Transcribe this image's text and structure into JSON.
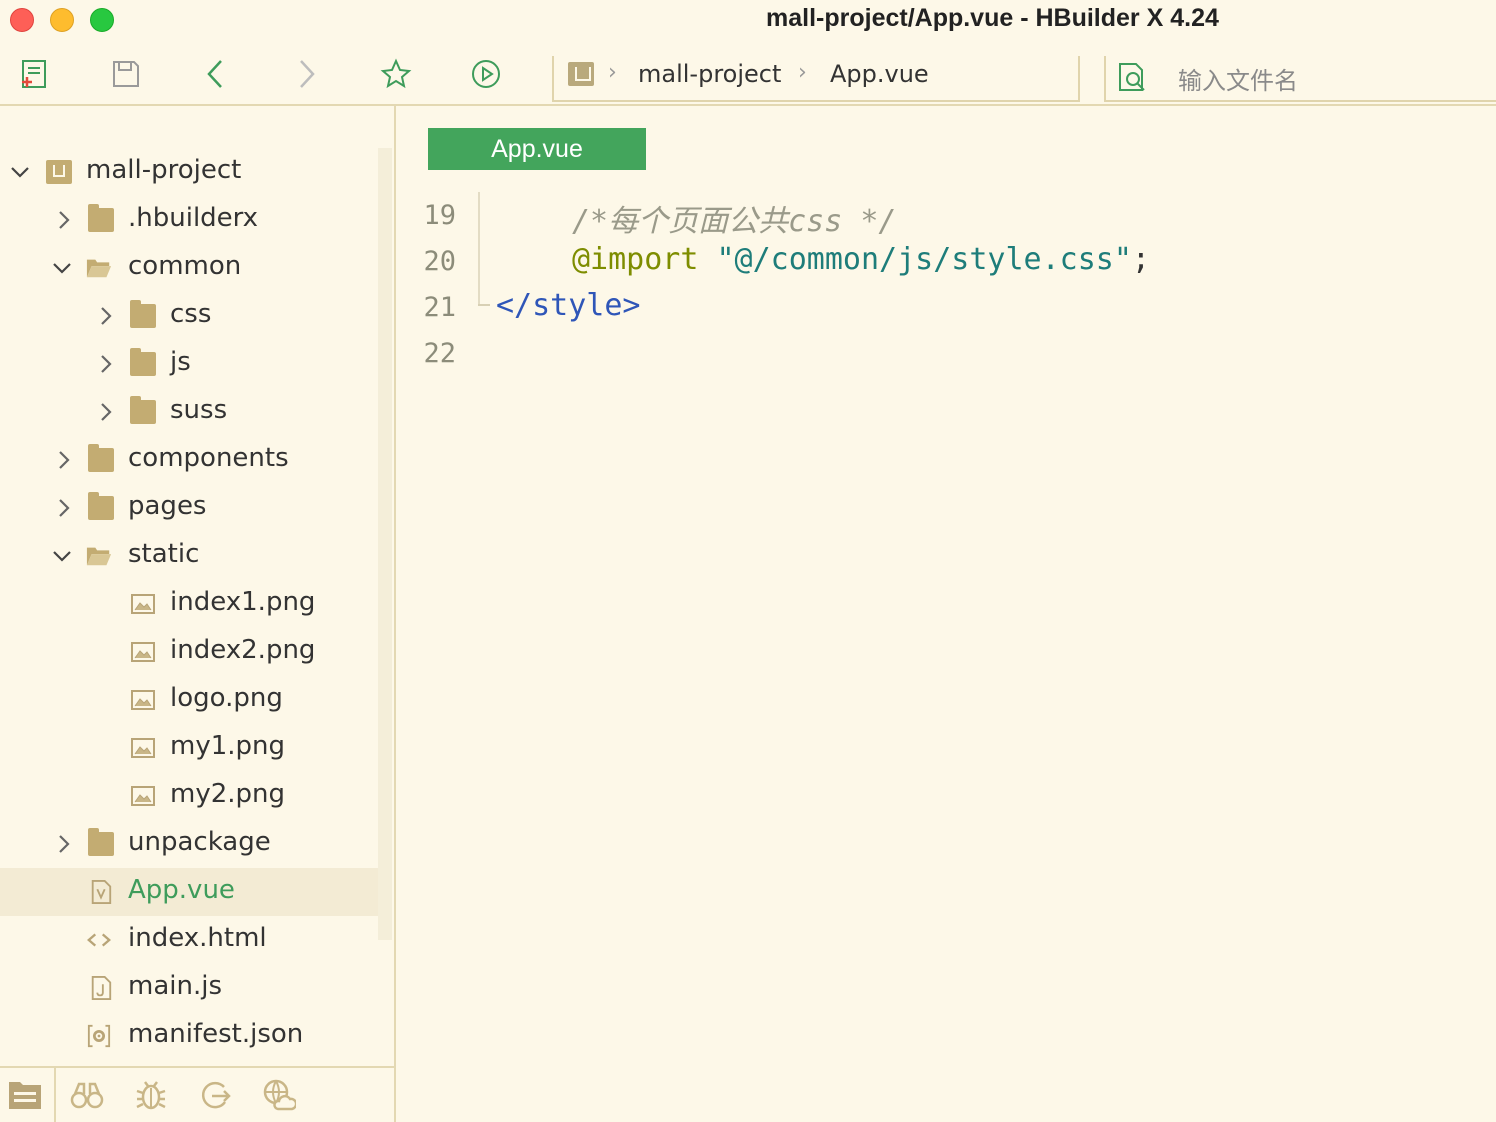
{
  "window": {
    "title": "mall-project/App.vue - HBuilder X 4.24"
  },
  "toolbar": {
    "icons": [
      "new-file-icon",
      "save-icon",
      "back-icon",
      "forward-icon",
      "favorite-icon",
      "run-icon"
    ],
    "breadcrumb": {
      "project": "mall-project",
      "file": "App.vue"
    },
    "search_placeholder": "输入文件名"
  },
  "sidebar": {
    "tree": [
      {
        "label": "mall-project",
        "type": "project",
        "expanded": true
      },
      {
        "label": ".hbuilderx",
        "type": "folder",
        "expanded": false
      },
      {
        "label": "common",
        "type": "folder",
        "expanded": true
      },
      {
        "label": "css",
        "type": "folder",
        "expanded": false
      },
      {
        "label": "js",
        "type": "folder",
        "expanded": false
      },
      {
        "label": "suss",
        "type": "folder",
        "expanded": false
      },
      {
        "label": "components",
        "type": "folder",
        "expanded": false
      },
      {
        "label": "pages",
        "type": "folder",
        "expanded": false
      },
      {
        "label": "static",
        "type": "folder",
        "expanded": true
      },
      {
        "label": "index1.png",
        "type": "image"
      },
      {
        "label": "index2.png",
        "type": "image"
      },
      {
        "label": "logo.png",
        "type": "image"
      },
      {
        "label": "my1.png",
        "type": "image"
      },
      {
        "label": "my2.png",
        "type": "image"
      },
      {
        "label": "unpackage",
        "type": "folder",
        "expanded": false
      },
      {
        "label": "App.vue",
        "type": "vue",
        "selected": true
      },
      {
        "label": "index.html",
        "type": "html"
      },
      {
        "label": "main.js",
        "type": "js"
      },
      {
        "label": "manifest.json",
        "type": "json"
      }
    ],
    "bottom_icons": [
      "project-manager-icon",
      "search-binoculars-icon",
      "debug-bug-icon",
      "git-icon",
      "cloud-icon"
    ]
  },
  "editor": {
    "active_tab": "App.vue",
    "lines": [
      {
        "number": "19",
        "comment": "/*每个页面公共css */"
      },
      {
        "number": "20",
        "at_rule": "@import",
        "string": "\"@/common/js/style.css\"",
        "punct": ";"
      },
      {
        "number": "21",
        "tag": "</style>"
      },
      {
        "number": "22"
      }
    ]
  },
  "colors": {
    "background": "#fdf8e8",
    "accent_green": "#43a55c",
    "folder": "#c3ac72"
  }
}
